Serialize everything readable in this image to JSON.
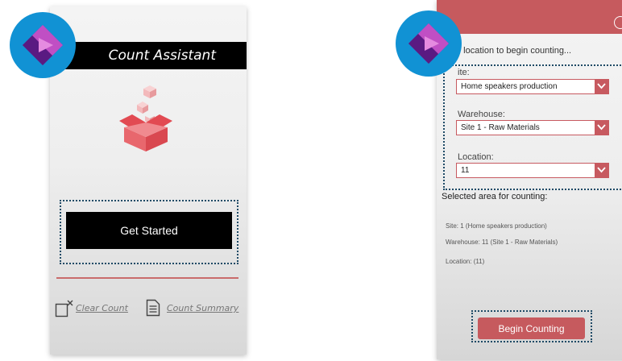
{
  "left_screen": {
    "title": "Count Assistant",
    "get_started_label": "Get Started",
    "clear_count_label": "Clear Count",
    "count_summary_label": "Count Summary"
  },
  "right_screen": {
    "prompt": "e location to begin counting...",
    "site_label": "ite:",
    "site_value": "Home speakers production",
    "warehouse_label": "Warehouse:",
    "warehouse_value": "Site 1 - Raw Materials",
    "location_label": "Location:",
    "location_value": "11",
    "selected_heading": "Selected area for counting:",
    "info_site": "Site: 1 (Home speakers production)",
    "info_warehouse": "Warehouse: 11 (Site 1 - Raw Materials)",
    "info_location": "Location:  (11)",
    "begin_label": "Begin Counting"
  },
  "icons": {
    "logo": "power-apps-logo-icon",
    "product": "open-box-icon",
    "clear": "clear-count-icon",
    "summary": "document-icon",
    "dropdown": "chevron-down-icon",
    "close": "close-icon"
  },
  "colors": {
    "accent_red": "#c65a5e",
    "title_black": "#000000",
    "logo_blue": "#1192d4",
    "logo_purple": "#7b2fa0",
    "highlight_dots": "#1e4a66"
  }
}
